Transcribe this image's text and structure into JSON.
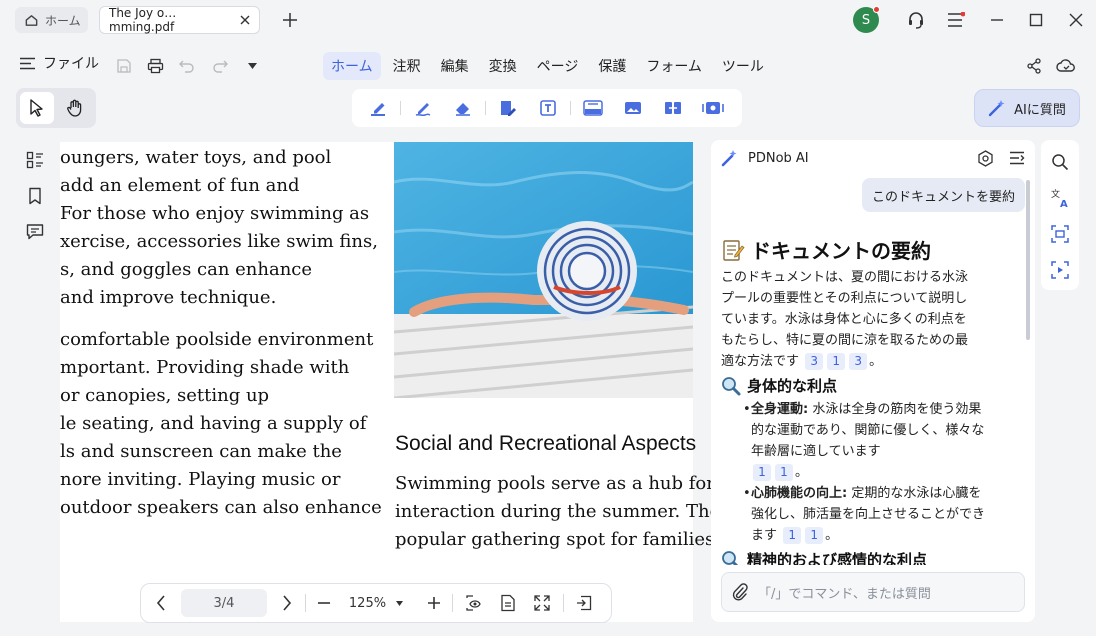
{
  "titlebar": {
    "home_tab": "ホーム",
    "doc_tab": "The Joy o…mming.pdf",
    "avatar_initial": "S"
  },
  "menubar": {
    "file_label": "ファイル",
    "items": [
      "ホーム",
      "注釈",
      "編集",
      "変換",
      "ページ",
      "保護",
      "フォーム",
      "ツール"
    ],
    "active": "ホーム"
  },
  "toolbar": {
    "ai_button": "AIに質問"
  },
  "document": {
    "left_lines_1": [
      "oungers, water toys, and pool",
      "add an element of fun and",
      " For those who enjoy swimming as",
      "xercise, accessories like swim fins,",
      "s, and goggles can enhance",
      "and improve technique."
    ],
    "left_lines_2": [
      "comfortable poolside environment",
      "mportant. Providing shade with",
      "or canopies, setting up",
      "le seating, and having a supply of",
      "ls and sunscreen can make the",
      "nore inviting. Playing music or",
      "outdoor speakers can also enhance"
    ],
    "section_heading": "Social and Recreational Aspects",
    "right_lines": [
      "Swimming pools serve as a hub for",
      "interaction during the summer. The",
      "popular gathering spot for families,"
    ]
  },
  "pager": {
    "page": "3/4",
    "zoom": "125%"
  },
  "ai_panel": {
    "title": "PDNob AI",
    "user_message": "このドキュメントを要約",
    "summary_heading": "ドキュメントの要約",
    "summary_text": "このドキュメントは、夏の間における水泳プールの重要性とその利点について説明しています。水泳は身体と心に多くの利点をもたらし、特に夏の間に涼を取るための最適な方法です",
    "summary_refs": [
      "3",
      "1",
      "3"
    ],
    "section1_heading": "身体的な利点",
    "b1_label": "全身運動:",
    "b1_text": "水泳は全身の筋肉を使う効果的な運動であり、関節に優しく、様々な年齢層に適しています",
    "b1_refs": [
      "1",
      "1"
    ],
    "b2_label": "心肺機能の向上:",
    "b2_text": "定期的な水泳は心臓を強化し、肺活量を向上させることができます",
    "b2_refs": [
      "1",
      "1"
    ],
    "section2_heading": "精神的および感情的な利点",
    "input_placeholder": "「/」でコマンド、または質問"
  },
  "colors": {
    "accent": "#3d63dd",
    "avatar": "#2f8a4f",
    "ai_button_bg": "#dde3f7"
  }
}
